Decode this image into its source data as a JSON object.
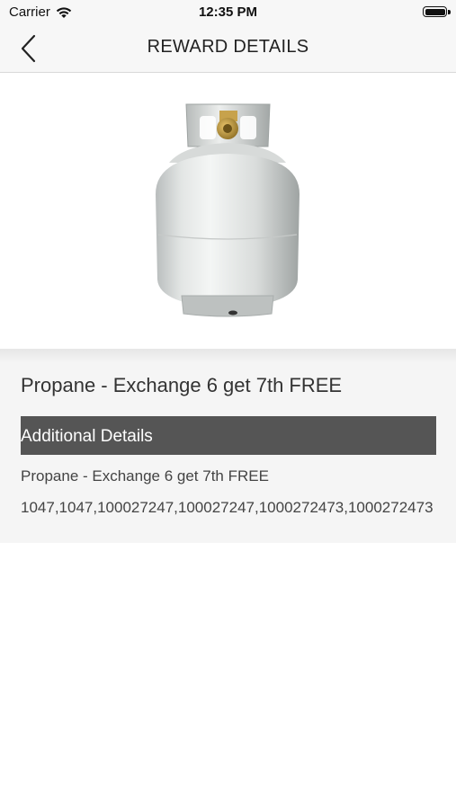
{
  "status_bar": {
    "carrier": "Carrier",
    "time": "12:35 PM"
  },
  "nav": {
    "title": "REWARD DETAILS",
    "back_icon": "chevron-left-icon"
  },
  "reward": {
    "image": "propane-tank",
    "title": "Propane - Exchange 6 get 7th FREE",
    "details_heading": "Additional Details",
    "description": "Propane - Exchange 6 get 7th FREE",
    "codes": "1047,1047,100027247,100027247,1000272473,1000272473"
  }
}
